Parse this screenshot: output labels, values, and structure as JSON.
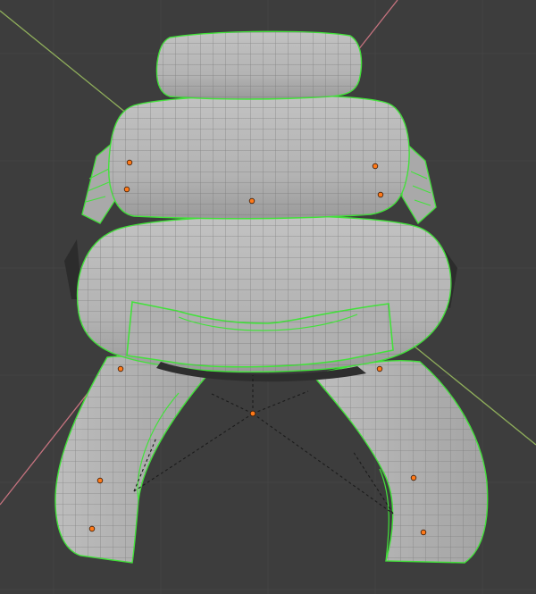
{
  "viewport": {
    "mode": "edit-mode",
    "object": "backpack-mesh",
    "colors": {
      "background": "#3d3d3d",
      "grid_line": "#444444",
      "axis_x": "#c6737f",
      "axis_y": "#8fae5b",
      "mesh_surface": "#b4b4b4",
      "mesh_shadow": "#8e8e8e",
      "wireframe": "#6c6c6c",
      "seam": "#42e23a",
      "vertex_marker": "#ff7a1a",
      "constraint_line": "#1b1b1b"
    }
  }
}
